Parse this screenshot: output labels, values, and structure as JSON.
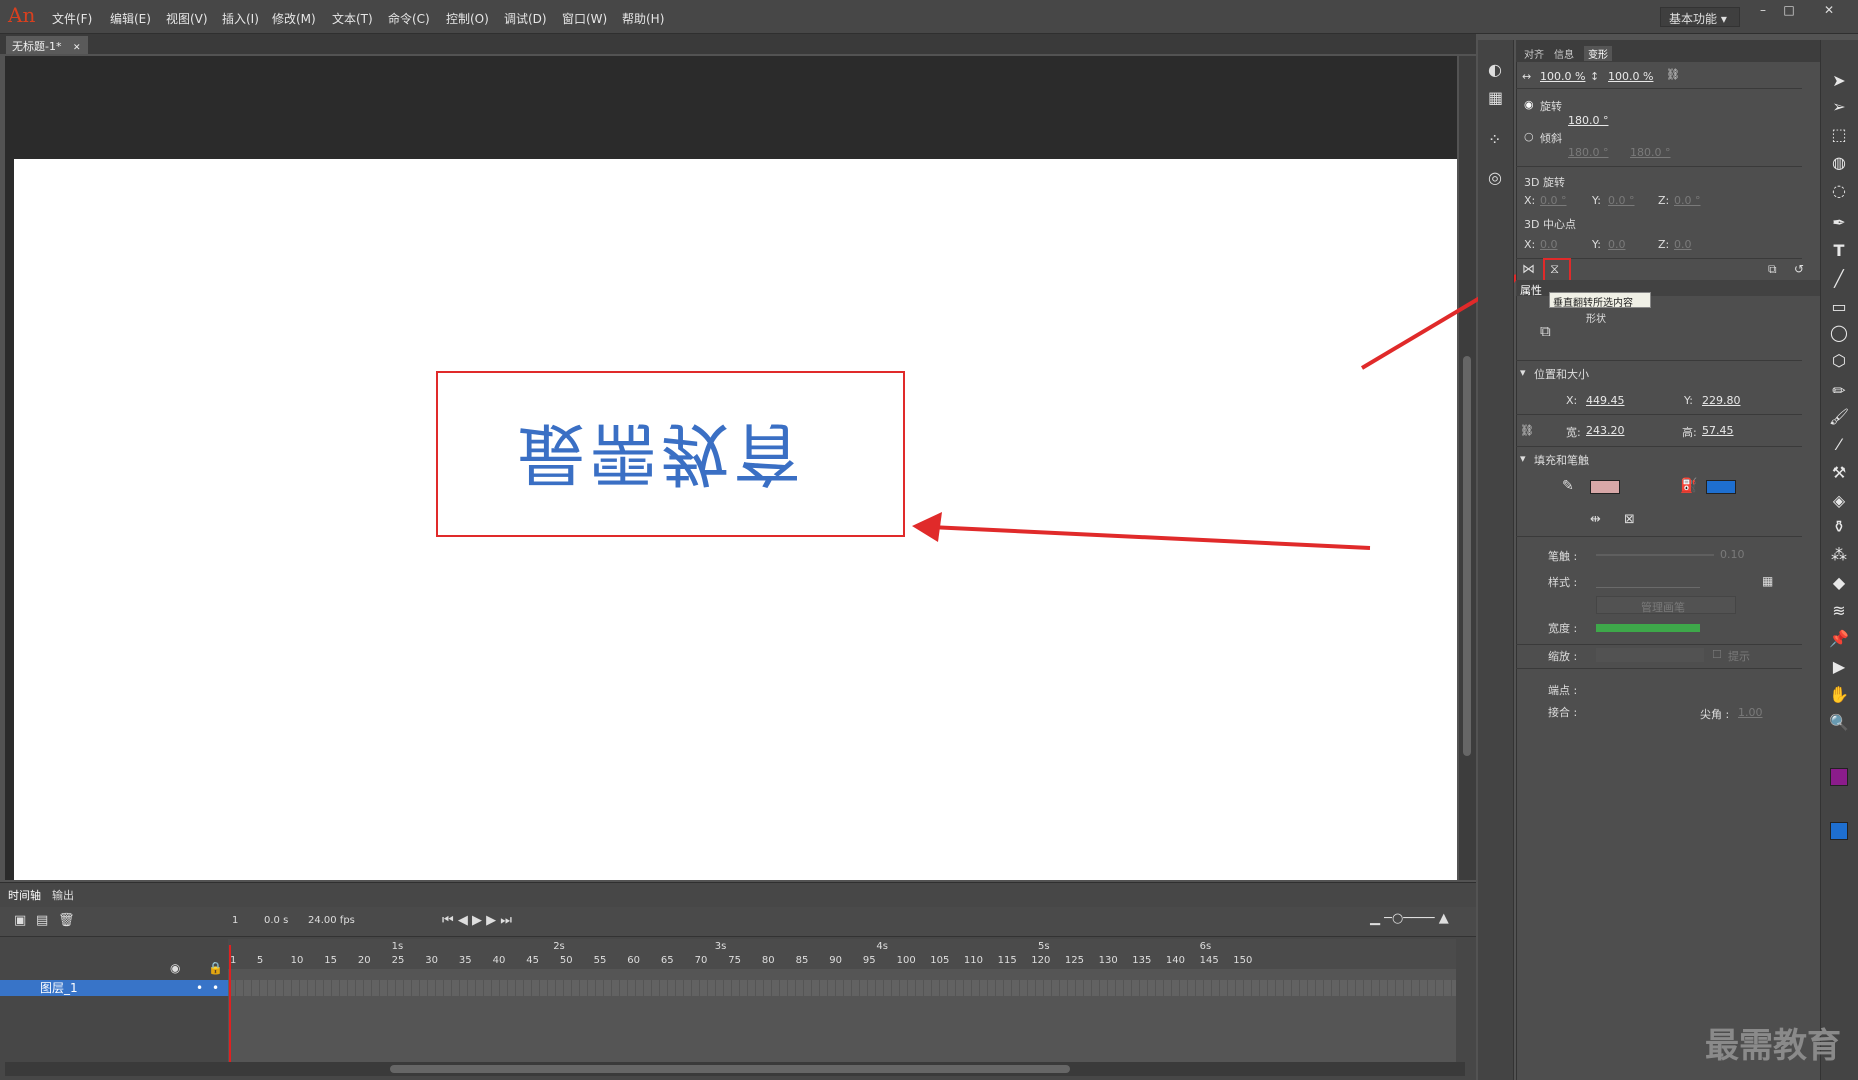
{
  "app": {
    "logo": "An",
    "workspace": "基本功能",
    "workspace_chevron": "▾"
  },
  "menu": [
    "文件(F)",
    "编辑(E)",
    "视图(V)",
    "插入(I)",
    "修改(M)",
    "文本(T)",
    "命令(C)",
    "控制(O)",
    "调试(D)",
    "窗口(W)",
    "帮助(H)"
  ],
  "window_controls": {
    "min": "–",
    "max": "□",
    "close": "✕"
  },
  "doc_tab": {
    "title": "无标题-1*",
    "close": "✕"
  },
  "stage": {
    "text": "最需教育",
    "text_color": "#3a6fc4"
  },
  "timeline": {
    "tabs": [
      "时间轴",
      "输出"
    ],
    "frame": "1",
    "time": "0.0 s",
    "fps": "24.00 fps",
    "seconds": [
      "1s",
      "2s",
      "3s",
      "4s",
      "5s",
      "6s"
    ],
    "frame_numbers": [
      "1",
      "5",
      "10",
      "15",
      "20",
      "25",
      "30",
      "35",
      "40",
      "45",
      "50",
      "55",
      "60",
      "65",
      "70",
      "75",
      "80",
      "85",
      "90",
      "95",
      "100",
      "105",
      "110",
      "115",
      "120",
      "125",
      "130",
      "135",
      "140",
      "145",
      "150"
    ],
    "layer": "图层_1",
    "dot": "•"
  },
  "transform_panel": {
    "tabs": [
      "对齐",
      "信息",
      "变形"
    ],
    "scale_w": "100.0 %",
    "scale_h": "100.0 %",
    "rotate_label": "旋转",
    "rotate_value": "180.0 °",
    "skew_label": "倾斜",
    "skew_h": "180.0 °",
    "skew_v": "180.0 °",
    "rot3d_label": "3D 旋转",
    "center3d_label": "3D 中心点",
    "x_label": "X:",
    "y_label": "Y:",
    "z_label": "Z:",
    "rot3d_x": "0.0 °",
    "rot3d_y": "0.0 °",
    "rot3d_z": "0.0 °",
    "c3d_x": "0.0",
    "c3d_y": "0.0",
    "c3d_z": "0.0",
    "tooltip": "垂直翻转所选内容"
  },
  "properties": {
    "tab": "属性",
    "type": "形状",
    "pos_section": "位置和大小",
    "x_label": "X:",
    "x": "449.45",
    "y_label": "Y:",
    "y": "229.80",
    "w_label": "宽:",
    "w": "243.20",
    "h_label": "高:",
    "h": "57.45",
    "fill_section": "填充和笔触",
    "stroke_label": "笔触 :",
    "stroke_value": "0.10",
    "style_label": "样式 :",
    "manage_brush": "管理画笔",
    "width_label": "宽度 :",
    "scale_label": "缩放 :",
    "hint_label": "提示",
    "cap_label": "端点 :",
    "join_label": "接合 :",
    "miter_label": "尖角 :",
    "miter_value": "1.00",
    "stroke_color": "#d8a8a8",
    "fill_color": "#1e6fd0"
  },
  "colors": {
    "stroke_swatch": "#8b1c8b",
    "fill_swatch": "#1e6fd0"
  },
  "watermark": "最需教育"
}
